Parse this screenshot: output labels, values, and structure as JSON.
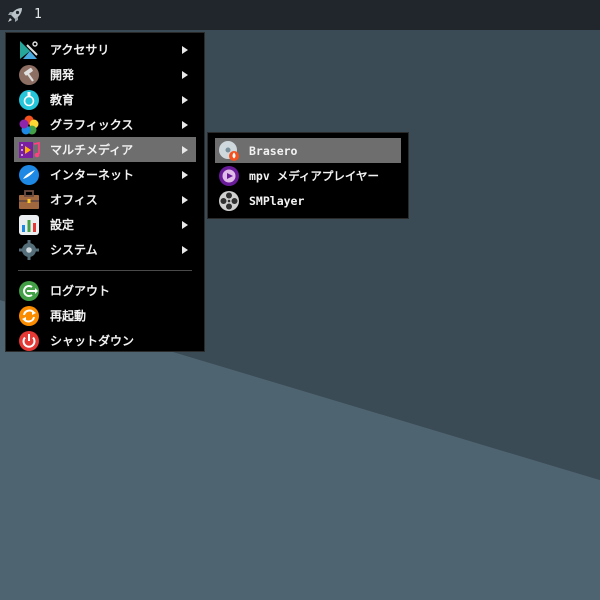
{
  "panel": {
    "workspace": "1",
    "launcher_icon": "rocket-icon"
  },
  "main_menu": {
    "items": [
      {
        "label": "アクセサリ",
        "icon": "accessories-icon",
        "submenu": true
      },
      {
        "label": "開発",
        "icon": "development-icon",
        "submenu": true
      },
      {
        "label": "教育",
        "icon": "education-icon",
        "submenu": true
      },
      {
        "label": "グラフィックス",
        "icon": "graphics-icon",
        "submenu": true
      },
      {
        "label": "マルチメディア",
        "icon": "multimedia-icon",
        "submenu": true,
        "active": true
      },
      {
        "label": "インターネット",
        "icon": "internet-icon",
        "submenu": true
      },
      {
        "label": "オフィス",
        "icon": "office-icon",
        "submenu": true
      },
      {
        "label": "設定",
        "icon": "settings-icon",
        "submenu": true
      },
      {
        "label": "システム",
        "icon": "system-icon",
        "submenu": true
      }
    ],
    "session_items": [
      {
        "label": "ログアウト",
        "icon": "logout-icon"
      },
      {
        "label": "再起動",
        "icon": "reboot-icon"
      },
      {
        "label": "シャットダウン",
        "icon": "shutdown-icon"
      }
    ]
  },
  "sub_menu": {
    "items": [
      {
        "label": "Brasero",
        "icon": "brasero-icon",
        "active": true
      },
      {
        "label": "mpv メディアプレイヤー",
        "icon": "mpv-icon"
      },
      {
        "label": "SMPlayer",
        "icon": "smplayer-icon"
      }
    ]
  },
  "colors": {
    "panel": "#20262b",
    "menu_bg": "#000000",
    "highlight": "#6e6e6e",
    "desktop_dark": "#3b4b55",
    "desktop_light": "#4f6570"
  }
}
